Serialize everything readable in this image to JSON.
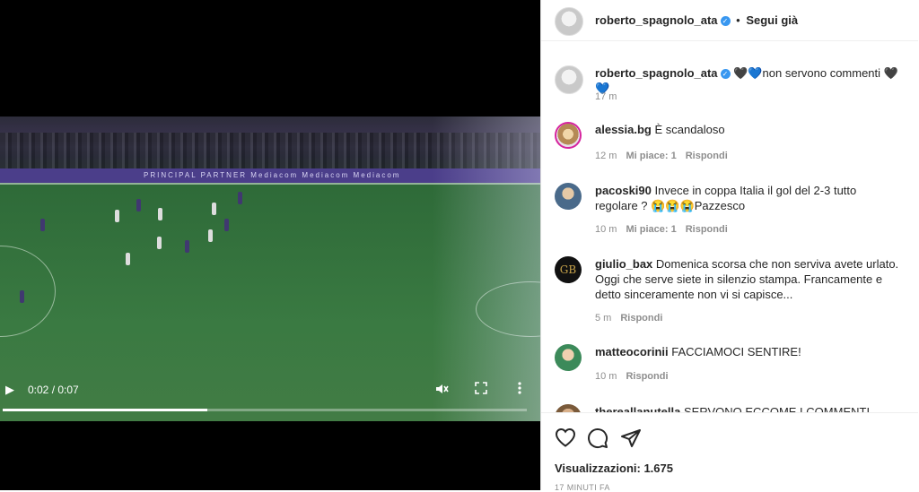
{
  "video": {
    "time": "0:02 / 0:07",
    "progress": 0.39,
    "banner_text": "PRINCIPAL PARTNER    Mediacom    Mediacom    Mediacom"
  },
  "post": {
    "author": "roberto_spagnolo_ata",
    "follow_status": "Segui già",
    "separator": "•",
    "caption_emojis_start": "🖤💙",
    "caption_text": "non servono commenti",
    "caption_emojis_end": "🖤💙",
    "caption_time": "17 m"
  },
  "comments": [
    {
      "user": "alessia.bg",
      "text": "È scandaloso",
      "time": "12 m",
      "likes": "Mi piace: 1",
      "reply": "Rispondi"
    },
    {
      "user": "pacoski90",
      "text": "Invece in coppa Italia il gol del 2-3 tutto regolare ? 😭😭😭Pazzesco",
      "time": "10 m",
      "likes": "Mi piace: 1",
      "reply": "Rispondi"
    },
    {
      "user": "giulio_bax",
      "text": "Domenica scorsa che non serviva avete urlato. Oggi che serve siete in silenzio stampa. Francamente e detto sinceramente non vi si capisce...",
      "time": "5 m",
      "likes": "",
      "reply": "Rispondi"
    },
    {
      "user": "matteocorinii",
      "text": "FACCIAMOCI SENTIRE!",
      "time": "10 m",
      "likes": "",
      "reply": "Rispondi"
    },
    {
      "user": "thereallanutella",
      "text": "SERVONO ECCOME I COMMENTI",
      "time": "",
      "likes": "",
      "reply": ""
    }
  ],
  "footer": {
    "views": "Visualizzazioni: 1.675",
    "date": "17 MINUTI FA",
    "icons": [
      "heart-icon",
      "comment-icon",
      "share-icon"
    ]
  },
  "colors": {
    "verified": "#3897f0",
    "muted": "#8e8e8e",
    "text": "#262626"
  }
}
